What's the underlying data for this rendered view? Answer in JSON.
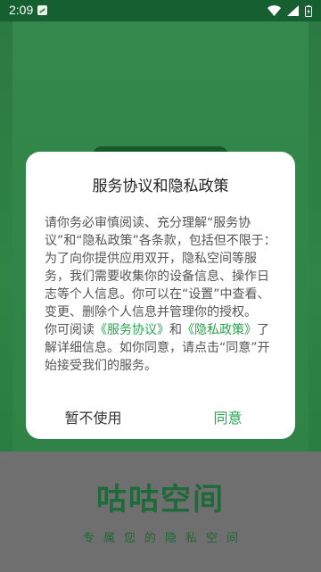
{
  "status_bar": {
    "time": "2:09",
    "app_notification_icon": "app-notification-icon",
    "wifi_icon": "wifi-icon",
    "signal_icon": "signal-icon",
    "battery_icon": "battery-icon"
  },
  "splash": {
    "brand_title": "咕咕空间",
    "slogan": "专属您的隐私空间",
    "colors": {
      "background": "#2e7a42",
      "brand_green": "#1e6a3a",
      "bottom_gray": "#706f6f"
    }
  },
  "dialog": {
    "title": "服务协议和隐私政策",
    "paragraph1": "请你务必审慎阅读、充分理解“服务协议”和“隐私政策”各条款，包括但不限于：为了向你提供应用双开，隐私空间等服务，我们需要收集你的设备信息、操作日志等个人信息。你可以在“设置”中查看、变更、删除个人信息并管理你的授权。",
    "p2_prefix": "你可阅读",
    "link_service": "《服务协议》",
    "p2_and": "和",
    "link_privacy": "《隐私政策》",
    "p2_suffix": "了解详细信息。如你同意，请点击“同意”开始接受我们的服务。",
    "decline_label": "暂不使用",
    "accept_label": "同意",
    "colors": {
      "accent": "#2aa44f",
      "text": "#555555"
    }
  }
}
